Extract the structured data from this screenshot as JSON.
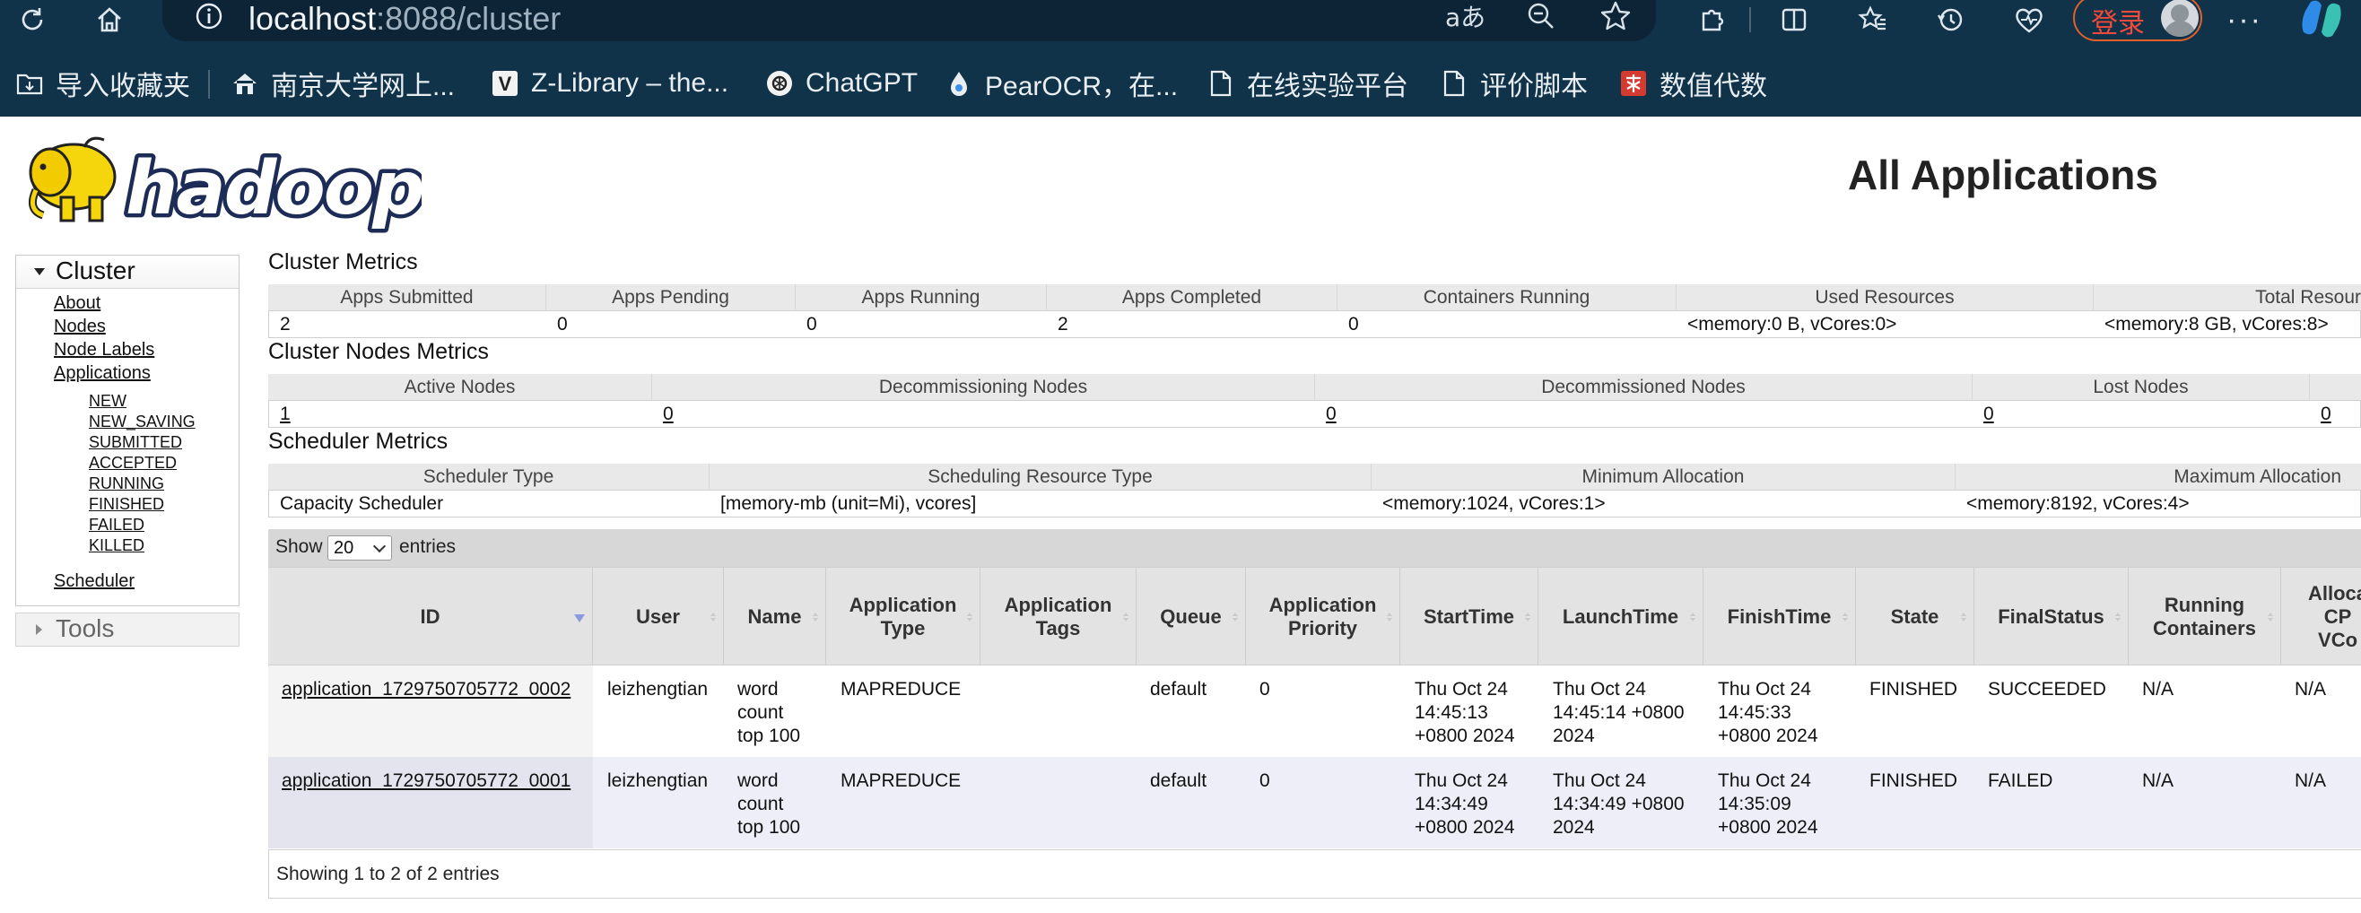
{
  "browser": {
    "url_host": "localhost",
    "url_rest": ":8088/cluster",
    "login_label": "登录",
    "bookmarks": [
      "导入收藏夹",
      "南京大学网上...",
      "Z-Library – the...",
      "ChatGPT",
      "PearOCR，在...",
      "在线实验平台",
      "评价脚本",
      "数值代数"
    ]
  },
  "header": {
    "title": "All Applications",
    "logo_text": "hadoop"
  },
  "sidebar": {
    "cluster_label": "Cluster",
    "links": [
      "About",
      "Nodes",
      "Node Labels",
      "Applications"
    ],
    "app_states": [
      "NEW",
      "NEW_SAVING",
      "SUBMITTED",
      "ACCEPTED",
      "RUNNING",
      "FINISHED",
      "FAILED",
      "KILLED"
    ],
    "scheduler": "Scheduler",
    "tools_label": "Tools"
  },
  "cluster_metrics": {
    "title": "Cluster Metrics",
    "headers": [
      "Apps Submitted",
      "Apps Pending",
      "Apps Running",
      "Apps Completed",
      "Containers Running",
      "Used Resources",
      "Total Resour"
    ],
    "values": [
      "2",
      "0",
      "0",
      "2",
      "0",
      "<memory:0 B, vCores:0>",
      "<memory:8 GB, vCores:8>"
    ]
  },
  "nodes_metrics": {
    "title": "Cluster Nodes Metrics",
    "headers": [
      "Active Nodes",
      "Decommissioning Nodes",
      "Decommissioned Nodes",
      "Lost Nodes",
      ""
    ],
    "values": [
      "1",
      "0",
      "0",
      "0",
      "0"
    ]
  },
  "scheduler_metrics": {
    "title": "Scheduler Metrics",
    "headers": [
      "Scheduler Type",
      "Scheduling Resource Type",
      "Minimum Allocation",
      "Maximum Allocation"
    ],
    "values": [
      "Capacity Scheduler",
      "[memory-mb (unit=Mi), vcores]",
      "<memory:1024, vCores:1>",
      "<memory:8192, vCores:4>"
    ]
  },
  "apps_table": {
    "show_label": "Show",
    "page_size": "20",
    "entries_label": "entries",
    "columns": [
      [
        "ID"
      ],
      [
        "User"
      ],
      [
        "Name"
      ],
      [
        "Application",
        "Type"
      ],
      [
        "Application",
        "Tags"
      ],
      [
        "Queue"
      ],
      [
        "Application",
        "Priority"
      ],
      [
        "StartTime"
      ],
      [
        "LaunchTime"
      ],
      [
        "FinishTime"
      ],
      [
        "State"
      ],
      [
        "FinalStatus"
      ],
      [
        "Running",
        "Containers"
      ],
      [
        "Alloca",
        "CP",
        "VCo"
      ]
    ],
    "rows": [
      {
        "id": "application_1729750705772_0002",
        "user": "leizhengtian",
        "name": [
          "word",
          "count",
          "top 100"
        ],
        "type": "MAPREDUCE",
        "tags": "",
        "queue": "default",
        "priority": "0",
        "start": [
          "Thu Oct 24",
          "14:45:13",
          "+0800 2024"
        ],
        "launch": [
          "Thu Oct 24",
          "14:45:14 +0800",
          "2024"
        ],
        "finish": [
          "Thu Oct 24",
          "14:45:33",
          "+0800 2024"
        ],
        "state": "FINISHED",
        "final_status": "SUCCEEDED",
        "running_containers": "N/A",
        "alloc_cpu": "N/A"
      },
      {
        "id": "application_1729750705772_0001",
        "user": "leizhengtian",
        "name": [
          "word",
          "count",
          "top 100"
        ],
        "type": "MAPREDUCE",
        "tags": "",
        "queue": "default",
        "priority": "0",
        "start": [
          "Thu Oct 24",
          "14:34:49",
          "+0800 2024"
        ],
        "launch": [
          "Thu Oct 24",
          "14:34:49 +0800",
          "2024"
        ],
        "finish": [
          "Thu Oct 24",
          "14:35:09",
          "+0800 2024"
        ],
        "state": "FINISHED",
        "final_status": "FAILED",
        "running_containers": "N/A",
        "alloc_cpu": "N/A"
      }
    ],
    "footer": "Showing 1 to 2 of 2 entries"
  },
  "colors": {
    "chrome_bg": "#103349",
    "row_alt_bg": "#eeeef8",
    "header_bg": "#e3e3e3",
    "logo_yellow": "#f5d60c"
  }
}
